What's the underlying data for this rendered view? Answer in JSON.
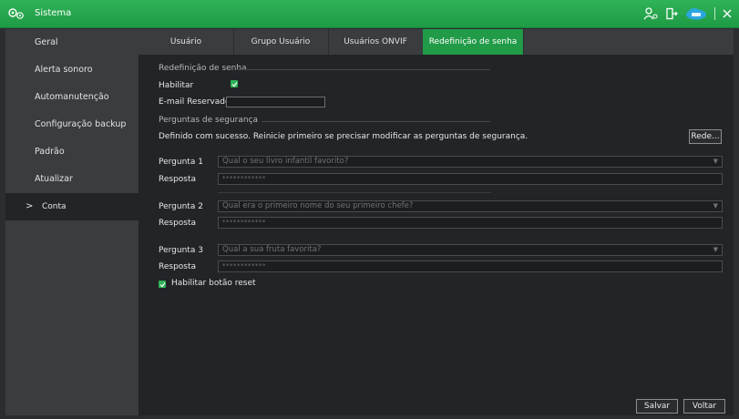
{
  "window": {
    "title": "Sistema"
  },
  "sidebar": {
    "items": [
      {
        "label": "Geral"
      },
      {
        "label": "Alerta sonoro"
      },
      {
        "label": "Automanutenção"
      },
      {
        "label": "Configuração backup"
      },
      {
        "label": "Padrão"
      },
      {
        "label": "Atualizar"
      },
      {
        "label": "Conta",
        "active": true,
        "chevron": ">"
      }
    ]
  },
  "tabs": [
    {
      "label": "Usuário"
    },
    {
      "label": "Grupo Usuário"
    },
    {
      "label": "Usuários ONVIF"
    },
    {
      "label": "Redefinição de senha",
      "active": true
    }
  ],
  "reset": {
    "section_title": "Redefinição de senha",
    "enable_label": "Habilitar",
    "enable_checked": true,
    "email_label": "E-mail Reservado",
    "email_value": ""
  },
  "security": {
    "section_title": "Perguntas de segurança",
    "success_message": "Definido com sucesso. Reinicie primeiro se precisar modificar as perguntas de segurança.",
    "reset_button": "Rede...",
    "questions": [
      {
        "label": "Pergunta 1",
        "value": "Qual o seu livro infantil favorito?",
        "answer_label": "Resposta",
        "answer_mask": "************"
      },
      {
        "label": "Pergunta 2",
        "value": "Qual era o primeiro nome do seu primeiro chefe?",
        "answer_label": "Resposta",
        "answer_mask": "************"
      },
      {
        "label": "Pergunta 3",
        "value": "Qual a sua fruta favorita?",
        "answer_label": "Resposta",
        "answer_mask": "************"
      }
    ]
  },
  "enable_reset_button": {
    "label": "Habilitar botão reset",
    "checked": true
  },
  "footer": {
    "save": "Salvar",
    "back": "Voltar"
  },
  "icons": {
    "logo": "settings-gear-icon",
    "user": "user-icon",
    "logout": "logout-icon",
    "cloud": "cloud-icon",
    "close": "close-icon"
  },
  "colors": {
    "accent": "#219b48",
    "titlebar": "#2fb358",
    "background": "#222427"
  }
}
